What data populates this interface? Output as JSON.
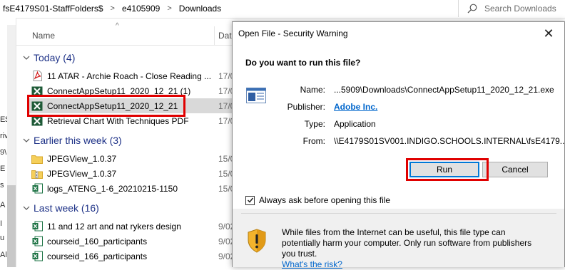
{
  "explorer": {
    "breadcrumbs": [
      "fsE4179S01-StaffFolders$",
      "e4105909",
      "Downloads"
    ],
    "search_placeholder": "Search Downloads",
    "left_nav_fragments": [
      "E$",
      "riv",
      "9\\",
      "E",
      "s",
      "A",
      "I",
      "u",
      "Al"
    ],
    "columns": {
      "name": "Name",
      "date": "Dat"
    },
    "groups": [
      {
        "label": "Today (4)"
      },
      {
        "label": "Earlier this week (3)"
      },
      {
        "label": "Last week (16)"
      }
    ],
    "files": [
      {
        "name": "11 ATAR - Archie Roach - Close Reading ...",
        "date": "17/0",
        "icon": "pdf-icon"
      },
      {
        "name": "ConnectAppSetup11_2020_12_21 (1)",
        "date": "17/0",
        "icon": "installer-icon"
      },
      {
        "name": "ConnectAppSetup11_2020_12_21",
        "date": "17/0",
        "icon": "installer-icon",
        "selected": true
      },
      {
        "name": "Retrieval Chart With Techniques PDF",
        "date": "17/0",
        "icon": "pdf-icon"
      },
      {
        "name": "JPEGView_1.0.37",
        "date": "15/0",
        "icon": "folder-icon"
      },
      {
        "name": "JPEGView_1.0.37",
        "date": "15/0",
        "icon": "zip-folder-icon"
      },
      {
        "name": "logs_ATENG_1-6_20210215-1150",
        "date": "15/0",
        "icon": "excel-icon"
      },
      {
        "name": "11 and 12 art and nat rykers design",
        "date": "9/02",
        "icon": "excel-icon"
      },
      {
        "name": "courseid_160_participants",
        "date": "9/02",
        "icon": "excel-icon"
      },
      {
        "name": "courseid_166_participants",
        "date": "9/02",
        "icon": "excel-icon"
      }
    ]
  },
  "dialog": {
    "title": "Open File - Security Warning",
    "close_glyph": "✕",
    "question": "Do you want to run this file?",
    "properties": [
      {
        "label": "Name:",
        "value": "...5909\\Downloads\\ConnectAppSetup11_2020_12_21.exe"
      },
      {
        "label": "Publisher:",
        "value": "Adobe Inc."
      },
      {
        "label": "Type:",
        "value": "Application"
      },
      {
        "label": "From:",
        "value": "\\\\E4179S01SV001.INDIGO.SCHOOLS.INTERNAL\\fsE4179..."
      }
    ],
    "run_label": "Run",
    "cancel_label": "Cancel",
    "checkbox_label": "Always ask before opening this file",
    "checkbox_checked": true,
    "warning_text": "While files from the Internet can be useful, this file type can potentially harm your computer. Only run software from publishers you trust.",
    "warning_link": "What's the risk?"
  },
  "colors": {
    "highlight_red": "#e00000",
    "link_blue": "#0066cc",
    "group_blue": "#1e3287",
    "selection_gray": "#d9d9d9"
  }
}
